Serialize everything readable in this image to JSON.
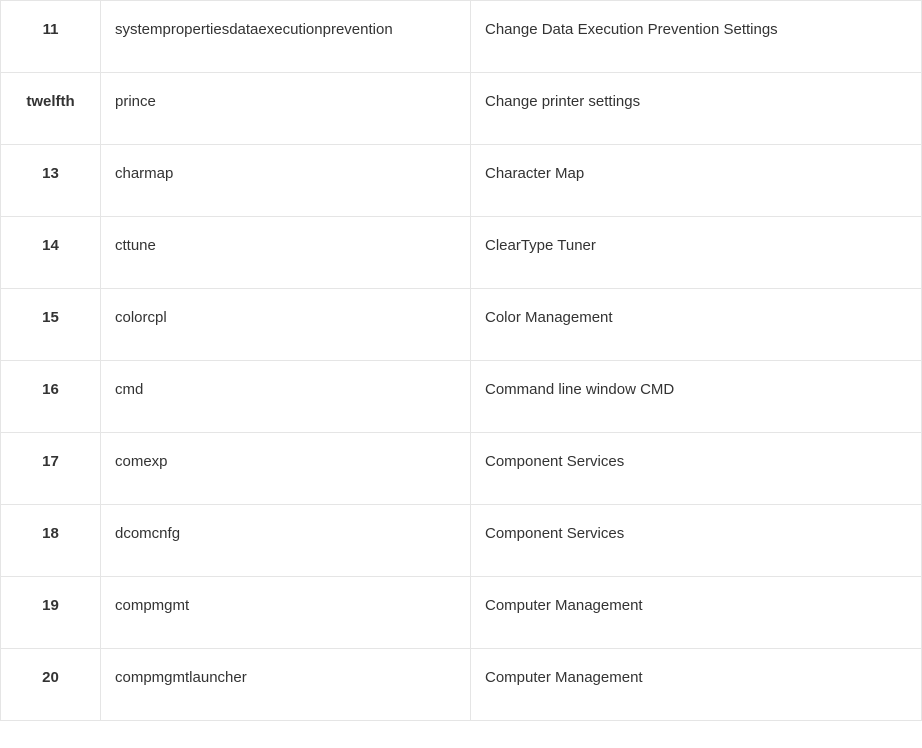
{
  "table": {
    "rows": [
      {
        "index": "11",
        "command": "systempropertiesdataexecutionprevention",
        "description": "Change Data Execution Prevention Settings"
      },
      {
        "index": "twelfth",
        "command": "prince",
        "description": "Change printer settings"
      },
      {
        "index": "13",
        "command": "charmap",
        "description": "Character Map"
      },
      {
        "index": "14",
        "command": "cttune",
        "description": "ClearType Tuner"
      },
      {
        "index": "15",
        "command": "colorcpl",
        "description": "Color Management"
      },
      {
        "index": "16",
        "command": "cmd",
        "description": "Command line window CMD"
      },
      {
        "index": "17",
        "command": "comexp",
        "description": "Component Services"
      },
      {
        "index": "18",
        "command": "dcomcnfg",
        "description": "Component Services"
      },
      {
        "index": "19",
        "command": "compmgmt",
        "description": "Computer Management"
      },
      {
        "index": "20",
        "command": "compmgmtlauncher",
        "description": "Computer Management"
      }
    ]
  }
}
